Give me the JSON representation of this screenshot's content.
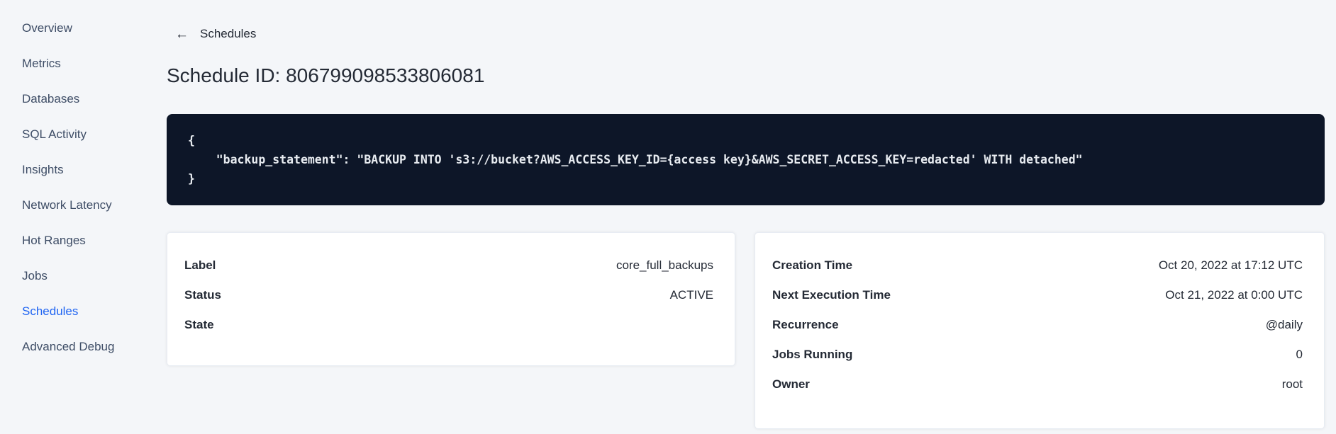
{
  "colors": {
    "page_background": "#f4f6f9",
    "accent_blue": "#2065f2",
    "code_background": "#0d1628",
    "code_text": "#e7ebf0",
    "text_dark": "#242a35",
    "sidebar_text": "#3e4d66"
  },
  "sidebar": {
    "items": [
      {
        "label": "Overview",
        "active": false
      },
      {
        "label": "Metrics",
        "active": false
      },
      {
        "label": "Databases",
        "active": false
      },
      {
        "label": "SQL Activity",
        "active": false
      },
      {
        "label": "Insights",
        "active": false
      },
      {
        "label": "Network Latency",
        "active": false
      },
      {
        "label": "Hot Ranges",
        "active": false
      },
      {
        "label": "Jobs",
        "active": false
      },
      {
        "label": "Schedules",
        "active": true
      },
      {
        "label": "Advanced Debug",
        "active": false
      }
    ]
  },
  "main": {
    "back_arrow": "←",
    "back_link": "Schedules",
    "title": "Schedule ID: 806799098533806081",
    "code": "{\n    \"backup_statement\": \"BACKUP INTO 's3://bucket?AWS_ACCESS_KEY_ID={access key}&AWS_SECRET_ACCESS_KEY=redacted' WITH detached\"\n}",
    "left_card": {
      "rows": [
        {
          "label": "Label",
          "value": "core_full_backups"
        },
        {
          "label": "Status",
          "value": "ACTIVE"
        },
        {
          "label": "State",
          "value": ""
        }
      ]
    },
    "right_card": {
      "rows": [
        {
          "label": "Creation Time",
          "value": "Oct 20, 2022 at 17:12 UTC"
        },
        {
          "label": "Next Execution Time",
          "value": "Oct 21, 2022 at 0:00 UTC"
        },
        {
          "label": "Recurrence",
          "value": "@daily"
        },
        {
          "label": "Jobs Running",
          "value": "0"
        },
        {
          "label": "Owner",
          "value": "root"
        }
      ]
    }
  }
}
